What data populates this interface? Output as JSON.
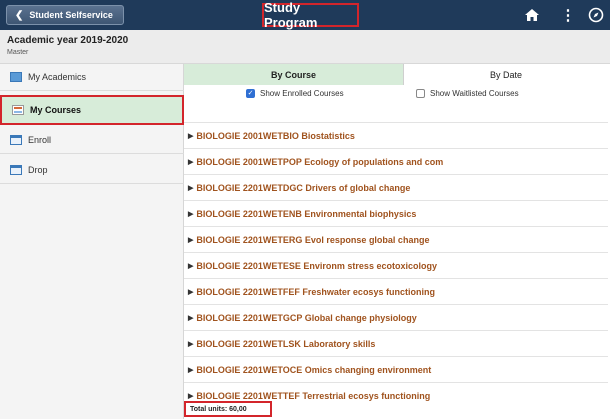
{
  "header": {
    "back_label": "Student Selfservice",
    "title": "Study Program",
    "icons": [
      "home-icon",
      "kebab-menu-icon",
      "compass-icon"
    ]
  },
  "subheader": {
    "academic_year": "Academic year 2019-2020",
    "level": "Master"
  },
  "sidebar": {
    "items": [
      {
        "label": "My Academics",
        "icon": "academics-icon"
      },
      {
        "label": "My Courses",
        "icon": "courses-icon",
        "active": true
      },
      {
        "label": "Enroll",
        "icon": "enroll-icon"
      },
      {
        "label": "Drop",
        "icon": "drop-icon"
      }
    ]
  },
  "main": {
    "tabs": [
      {
        "label": "By Course",
        "active": true
      },
      {
        "label": "By Date",
        "active": false
      }
    ],
    "filters": [
      {
        "label": "Show Enrolled Courses",
        "checked": true
      },
      {
        "label": "Show Waitlisted Courses",
        "checked": false
      }
    ],
    "courses": [
      "BIOLOGIE 2001WETBIO Biostatistics",
      "BIOLOGIE 2001WETPOP Ecology of populations and com",
      "BIOLOGIE 2201WETDGC Drivers of global change",
      "BIOLOGIE 2201WETENB Environmental biophysics",
      "BIOLOGIE 2201WETERG Evol response global change",
      "BIOLOGIE 2201WETESE Environm stress ecotoxicology",
      "BIOLOGIE 2201WETFEF Freshwater ecosys functioning",
      "BIOLOGIE 2201WETGCP Global change physiology",
      "BIOLOGIE 2201WETLSK Laboratory skills",
      "BIOLOGIE 2201WETOCE Omics changing environment",
      "BIOLOGIE 2201WETTEF Terrestrial ecosys functioning"
    ],
    "total_units": "Total units: 60,00"
  },
  "colors": {
    "header_bg": "#1f3a5a",
    "highlight_red": "#d3252b",
    "active_green": "#d7ecd9",
    "course_link": "#a0531e"
  }
}
